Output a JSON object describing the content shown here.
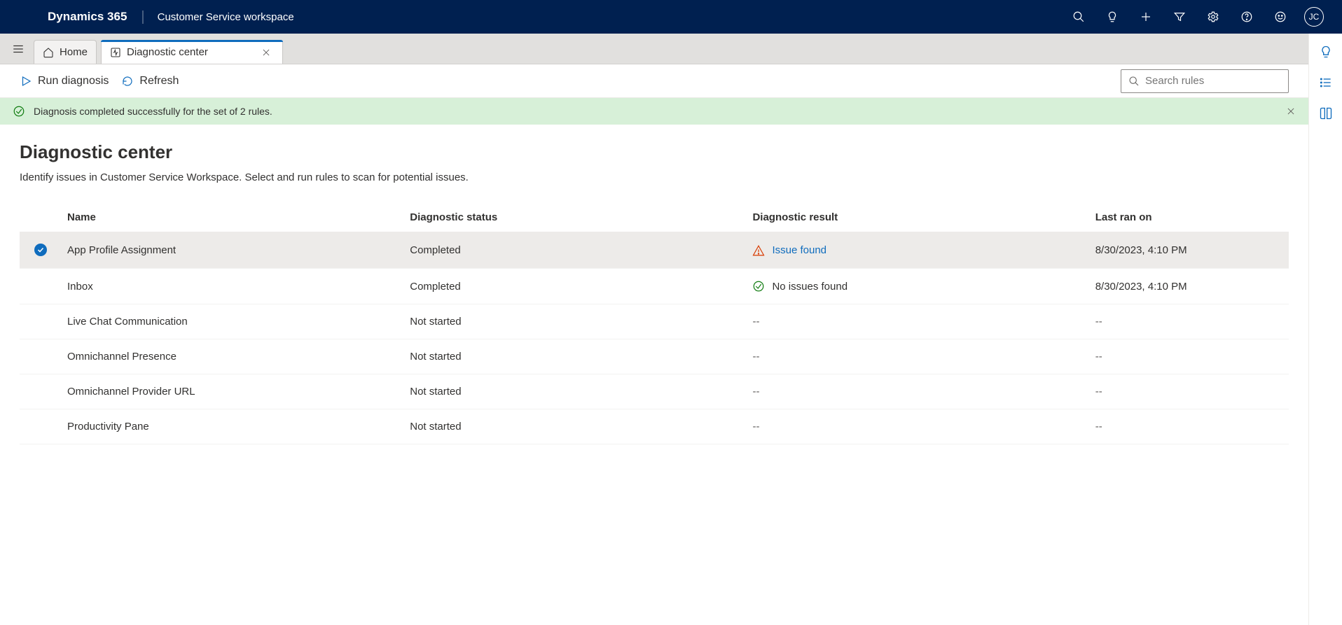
{
  "header": {
    "brand": "Dynamics 365",
    "workspace": "Customer Service workspace",
    "avatar": "JC"
  },
  "tabs": {
    "home": "Home",
    "active": "Diagnostic center"
  },
  "commands": {
    "run": "Run diagnosis",
    "refresh": "Refresh",
    "search_placeholder": "Search rules"
  },
  "notification": {
    "text": "Diagnosis completed successfully for the set of 2 rules."
  },
  "page": {
    "title": "Diagnostic center",
    "subtitle": "Identify issues in Customer Service Workspace. Select and run rules to scan for potential issues."
  },
  "table": {
    "headers": {
      "name": "Name",
      "status": "Diagnostic status",
      "result": "Diagnostic result",
      "last": "Last ran on"
    },
    "rows": [
      {
        "selected": true,
        "name": "App Profile Assignment",
        "status": "Completed",
        "result_type": "issue",
        "result": "Issue found",
        "last": "8/30/2023, 4:10 PM"
      },
      {
        "selected": false,
        "name": "Inbox",
        "status": "Completed",
        "result_type": "ok",
        "result": "No issues found",
        "last": "8/30/2023, 4:10 PM"
      },
      {
        "selected": false,
        "name": "Live Chat Communication",
        "status": "Not started",
        "result_type": "none",
        "result": "--",
        "last": "--"
      },
      {
        "selected": false,
        "name": "Omnichannel Presence",
        "status": "Not started",
        "result_type": "none",
        "result": "--",
        "last": "--"
      },
      {
        "selected": false,
        "name": "Omnichannel Provider URL",
        "status": "Not started",
        "result_type": "none",
        "result": "--",
        "last": "--"
      },
      {
        "selected": false,
        "name": "Productivity Pane",
        "status": "Not started",
        "result_type": "none",
        "result": "--",
        "last": "--"
      }
    ]
  }
}
